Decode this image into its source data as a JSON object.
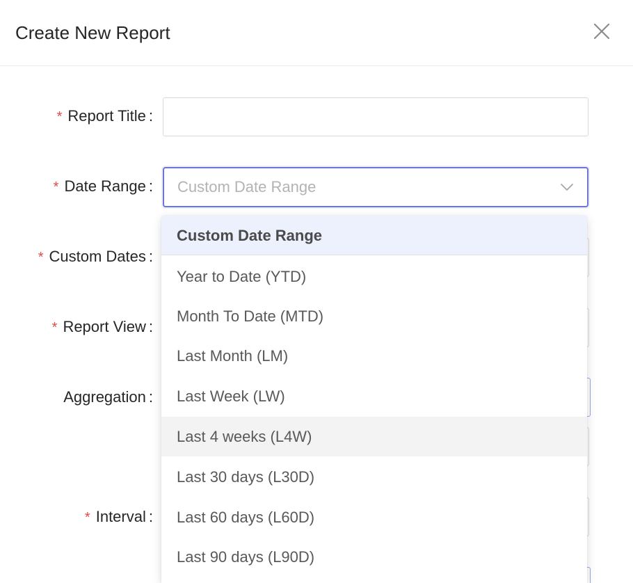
{
  "modal": {
    "title": "Create New Report"
  },
  "form": {
    "report_title": {
      "label": "Report Title",
      "value": ""
    },
    "date_range": {
      "label": "Date Range",
      "placeholder": "Custom Date Range"
    },
    "custom_dates": {
      "label": "Custom Dates"
    },
    "report_view": {
      "label": "Report View"
    },
    "aggregation": {
      "label": "Aggregation"
    },
    "interval": {
      "label": "Interval"
    },
    "colon": ":",
    "required_mark": "*"
  },
  "dropdown": {
    "selected": "Custom Date Range",
    "hovered": "Last 4 weeks (L4W)",
    "options": [
      "Custom Date Range",
      "Year to Date (YTD)",
      "Month To Date (MTD)",
      "Last Month (LM)",
      "Last Week (LW)",
      "Last 4 weeks (L4W)",
      "Last 30 days (L30D)",
      "Last 60 days (L60D)",
      "Last 90 days (L90D)"
    ]
  },
  "icons": {
    "close": "close-icon",
    "select_arrow": "chevron-down-icon"
  },
  "colors": {
    "required": "#e54848",
    "focus_border": "#6b76d6",
    "selected_bg": "#edf0fd",
    "hover_bg": "#f3f3f3"
  }
}
